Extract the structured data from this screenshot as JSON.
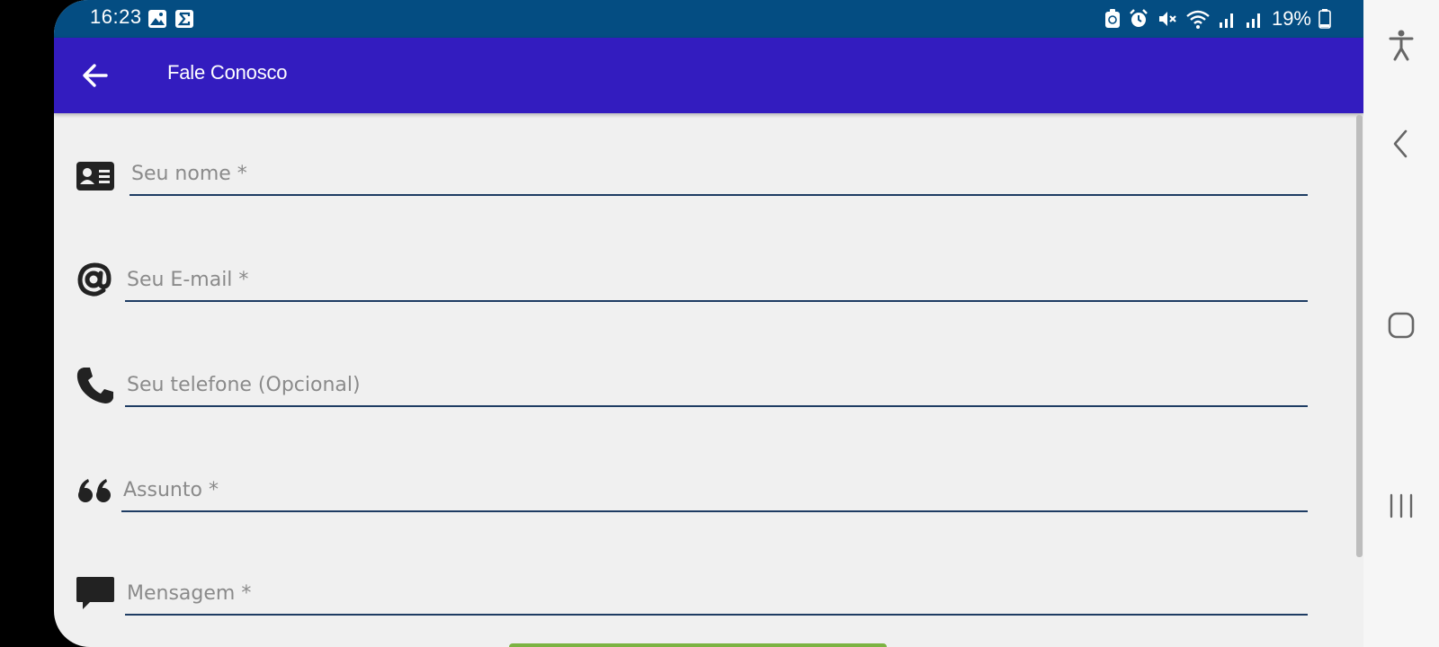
{
  "status_bar": {
    "time": "16:23",
    "battery_percent": "19%",
    "battery_level": 0.19,
    "left_icons": [
      "image-icon",
      "sigma-icon"
    ],
    "right_icons": [
      "recycle-lock-icon",
      "alarm-icon",
      "mute-icon",
      "wifi-icon",
      "signal-icon",
      "signal-icon"
    ]
  },
  "app_bar": {
    "title": "Fale Conosco",
    "back_icon": "arrow-left-icon",
    "color": "#331cbf"
  },
  "form": {
    "fields": [
      {
        "name": "name",
        "icon": "id-card-icon",
        "placeholder": "Seu nome *",
        "value": ""
      },
      {
        "name": "email",
        "icon": "at-sign-icon",
        "placeholder": "Seu E-mail *",
        "value": ""
      },
      {
        "name": "phone",
        "icon": "phone-icon",
        "placeholder": "Seu telefone (Opcional)",
        "value": ""
      },
      {
        "name": "subject",
        "icon": "quote-icon",
        "placeholder": "Assunto *",
        "value": ""
      },
      {
        "name": "message",
        "icon": "chat-bubble-icon",
        "placeholder": "Mensagem *",
        "value": ""
      }
    ]
  },
  "nav_bar": {
    "buttons": [
      "accessibility-icon",
      "back-chevron-icon",
      "home-icon",
      "recents-icon"
    ]
  },
  "colors": {
    "status_bar": "#044d82",
    "app_bar": "#331cbf",
    "underline": "#1e3c63",
    "background": "#f0f0f0"
  }
}
